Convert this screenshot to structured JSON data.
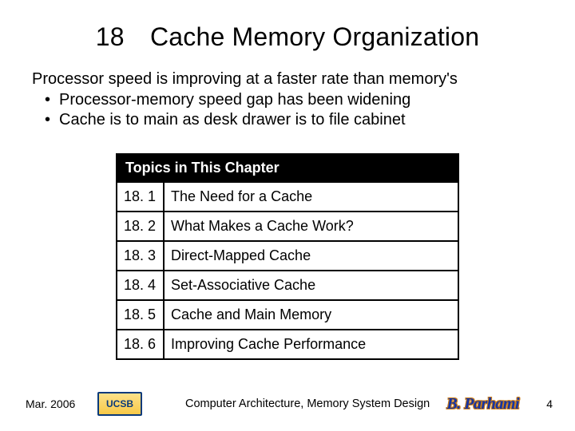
{
  "title": "18 Cache Memory Organization",
  "intro": {
    "lead": "Processor speed is improving at a faster rate than memory's",
    "bullets": [
      "Processor-memory speed gap has been widening",
      "Cache is to main as desk drawer is to file cabinet"
    ]
  },
  "topics": {
    "header": "Topics in This Chapter",
    "rows": [
      {
        "num": "18. 1",
        "title": "The Need for a Cache"
      },
      {
        "num": "18. 2",
        "title": "What Makes a Cache Work?"
      },
      {
        "num": "18. 3",
        "title": "Direct-Mapped Cache"
      },
      {
        "num": "18. 4",
        "title": "Set-Associative Cache"
      },
      {
        "num": "18. 5",
        "title": "Cache and Main Memory"
      },
      {
        "num": "18. 6",
        "title": "Improving Cache Performance"
      }
    ]
  },
  "footer": {
    "date": "Mar. 2006",
    "logo": "UCSB",
    "center": "Computer Architecture, Memory System Design",
    "author": "B. Parhami",
    "page": "4"
  }
}
